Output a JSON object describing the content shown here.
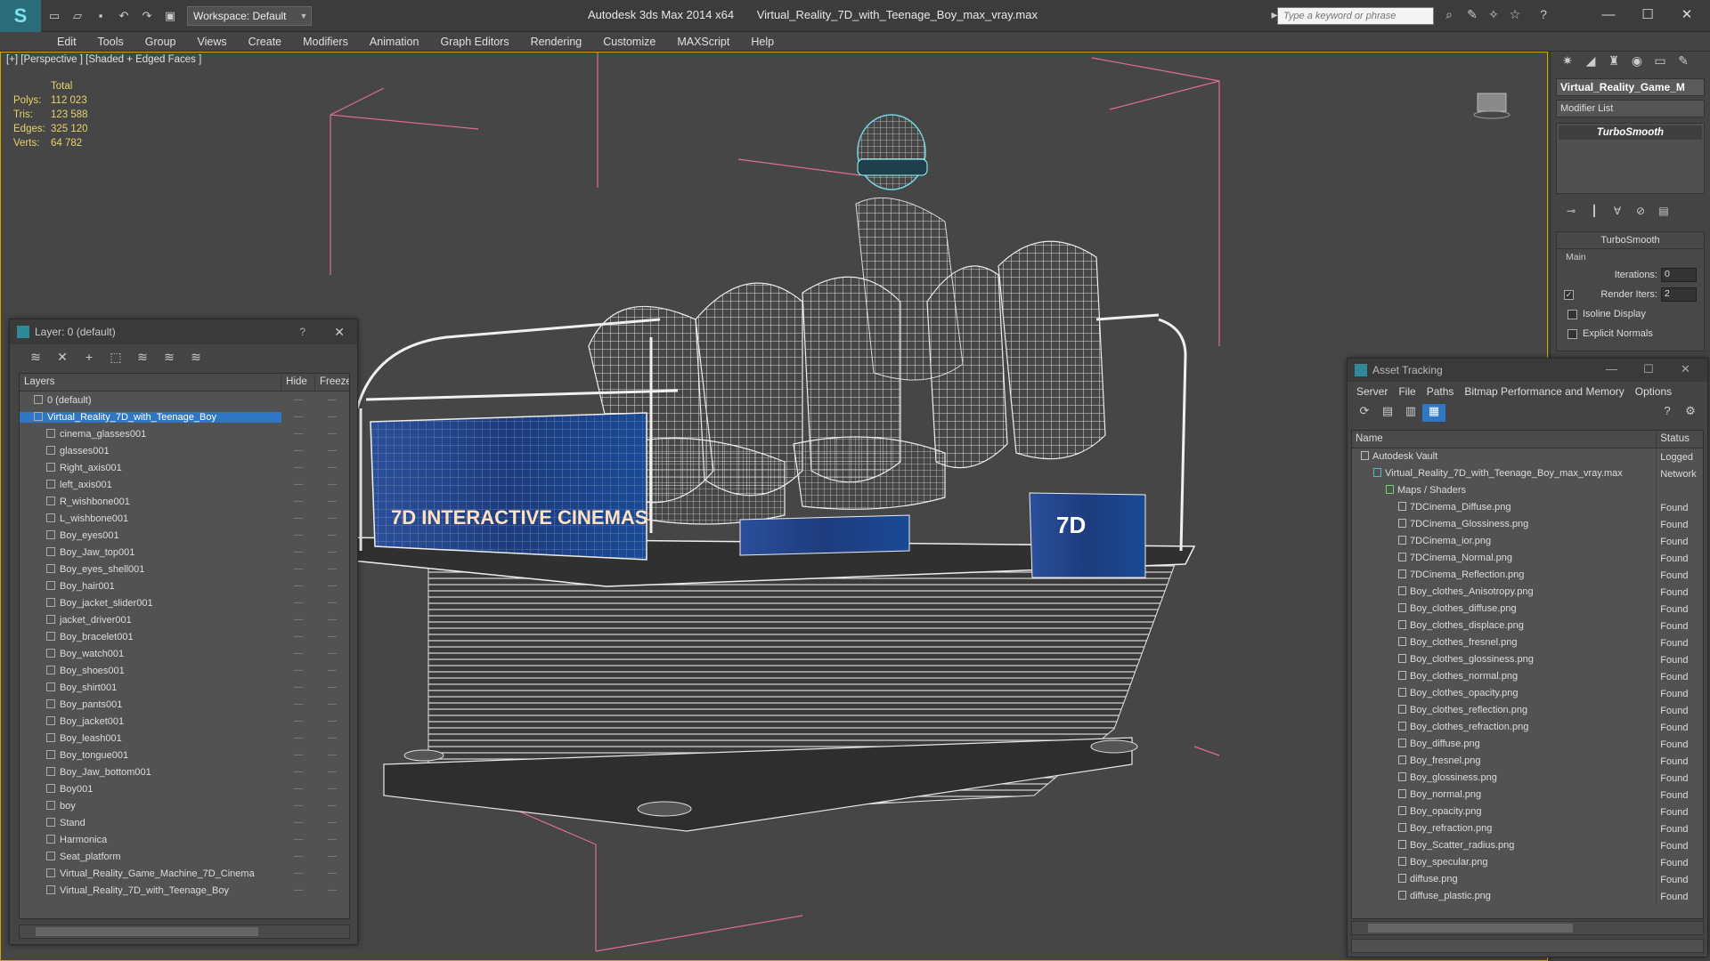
{
  "titlebar": {
    "workspace": "Workspace: Default",
    "app_title": "Autodesk 3ds Max  2014 x64",
    "file_title": "Virtual_Reality_7D_with_Teenage_Boy_max_vray.max",
    "search_placeholder": "Type a keyword or phrase"
  },
  "menu": [
    "Edit",
    "Tools",
    "Group",
    "Views",
    "Create",
    "Modifiers",
    "Animation",
    "Graph Editors",
    "Rendering",
    "Customize",
    "MAXScript",
    "Help"
  ],
  "viewport": {
    "label": "[+] [Perspective ] [Shaded + Edged Faces ]",
    "stats": {
      "header": "Total",
      "rows": [
        {
          "k": "Polys:",
          "v": "112 023"
        },
        {
          "k": "Tris:",
          "v": "123 588"
        },
        {
          "k": "Edges:",
          "v": "325 120"
        },
        {
          "k": "Verts:",
          "v": "64 782"
        }
      ]
    },
    "poster_text": "7D INTERACTIVE CINEMAS",
    "badge_text": "7D"
  },
  "layer_dialog": {
    "title": "Layer: 0 (default)",
    "help": "?",
    "columns": {
      "layers": "Layers",
      "hide": "Hide",
      "freeze": "Freeze"
    },
    "layers": [
      {
        "name": "0 (default)",
        "level": 1,
        "kind": "layer"
      },
      {
        "name": "Virtual_Reality_7D_with_Teenage_Boy",
        "level": 1,
        "kind": "layer",
        "selected": true
      },
      {
        "name": "cinema_glasses001",
        "level": 2,
        "kind": "obj"
      },
      {
        "name": "glasses001",
        "level": 2,
        "kind": "obj"
      },
      {
        "name": "Right_axis001",
        "level": 2,
        "kind": "obj"
      },
      {
        "name": "left_axis001",
        "level": 2,
        "kind": "obj"
      },
      {
        "name": "R_wishbone001",
        "level": 2,
        "kind": "obj"
      },
      {
        "name": "L_wishbone001",
        "level": 2,
        "kind": "obj"
      },
      {
        "name": "Boy_eyes001",
        "level": 2,
        "kind": "obj"
      },
      {
        "name": "Boy_Jaw_top001",
        "level": 2,
        "kind": "obj"
      },
      {
        "name": "Boy_eyes_shell001",
        "level": 2,
        "kind": "obj"
      },
      {
        "name": "Boy_hair001",
        "level": 2,
        "kind": "obj"
      },
      {
        "name": "Boy_jacket_slider001",
        "level": 2,
        "kind": "obj"
      },
      {
        "name": "jacket_driver001",
        "level": 2,
        "kind": "obj"
      },
      {
        "name": "Boy_bracelet001",
        "level": 2,
        "kind": "obj"
      },
      {
        "name": "Boy_watch001",
        "level": 2,
        "kind": "obj"
      },
      {
        "name": "Boy_shoes001",
        "level": 2,
        "kind": "obj"
      },
      {
        "name": "Boy_shirt001",
        "level": 2,
        "kind": "obj"
      },
      {
        "name": "Boy_pants001",
        "level": 2,
        "kind": "obj"
      },
      {
        "name": "Boy_jacket001",
        "level": 2,
        "kind": "obj"
      },
      {
        "name": "Boy_leash001",
        "level": 2,
        "kind": "obj"
      },
      {
        "name": "Boy_tongue001",
        "level": 2,
        "kind": "obj"
      },
      {
        "name": "Boy_Jaw_bottom001",
        "level": 2,
        "kind": "obj"
      },
      {
        "name": "Boy001",
        "level": 2,
        "kind": "obj"
      },
      {
        "name": "boy",
        "level": 2,
        "kind": "obj"
      },
      {
        "name": "Stand",
        "level": 2,
        "kind": "obj"
      },
      {
        "name": "Harmonica",
        "level": 2,
        "kind": "obj"
      },
      {
        "name": "Seat_platform",
        "level": 2,
        "kind": "obj"
      },
      {
        "name": "Virtual_Reality_Game_Machine_7D_Cinema",
        "level": 2,
        "kind": "obj"
      },
      {
        "name": "Virtual_Reality_7D_with_Teenage_Boy",
        "level": 2,
        "kind": "obj"
      }
    ]
  },
  "command_panel": {
    "object_name": "Virtual_Reality_Game_M",
    "modifier_list": "Modifier List",
    "stack_entry": "TurboSmooth",
    "rollout_title": "TurboSmooth",
    "group_main": "Main",
    "iterations_label": "Iterations:",
    "iterations_value": "0",
    "render_iters_label": "Render Iters:",
    "render_iters_value": "2",
    "render_iters_checked": true,
    "isoline_label": "Isoline Display",
    "explicit_label": "Explicit Normals"
  },
  "asset_dialog": {
    "title": "Asset Tracking",
    "menu": [
      "Server",
      "File",
      "Paths",
      "Bitmap Performance and Memory",
      "Options"
    ],
    "columns": {
      "name": "Name",
      "status": "Status"
    },
    "rows": [
      {
        "name": "Autodesk Vault",
        "status": "Logged",
        "level": 1,
        "kind": "vault"
      },
      {
        "name": "Virtual_Reality_7D_with_Teenage_Boy_max_vray.max",
        "status": "Network",
        "level": 2,
        "kind": "max"
      },
      {
        "name": "Maps / Shaders",
        "status": "",
        "level": 3,
        "kind": "folder"
      },
      {
        "name": "7DCinema_Diffuse.png",
        "status": "Found",
        "level": 4,
        "kind": "file"
      },
      {
        "name": "7DCinema_Glossiness.png",
        "status": "Found",
        "level": 4,
        "kind": "file"
      },
      {
        "name": "7DCinema_ior.png",
        "status": "Found",
        "level": 4,
        "kind": "file"
      },
      {
        "name": "7DCinema_Normal.png",
        "status": "Found",
        "level": 4,
        "kind": "file"
      },
      {
        "name": "7DCinema_Reflection.png",
        "status": "Found",
        "level": 4,
        "kind": "file"
      },
      {
        "name": "Boy_clothes_Anisotropy.png",
        "status": "Found",
        "level": 4,
        "kind": "file"
      },
      {
        "name": "Boy_clothes_diffuse.png",
        "status": "Found",
        "level": 4,
        "kind": "file"
      },
      {
        "name": "Boy_clothes_displace.png",
        "status": "Found",
        "level": 4,
        "kind": "file"
      },
      {
        "name": "Boy_clothes_fresnel.png",
        "status": "Found",
        "level": 4,
        "kind": "file"
      },
      {
        "name": "Boy_clothes_glossiness.png",
        "status": "Found",
        "level": 4,
        "kind": "file"
      },
      {
        "name": "Boy_clothes_normal.png",
        "status": "Found",
        "level": 4,
        "kind": "file"
      },
      {
        "name": "Boy_clothes_opacity.png",
        "status": "Found",
        "level": 4,
        "kind": "file"
      },
      {
        "name": "Boy_clothes_reflection.png",
        "status": "Found",
        "level": 4,
        "kind": "file"
      },
      {
        "name": "Boy_clothes_refraction.png",
        "status": "Found",
        "level": 4,
        "kind": "file"
      },
      {
        "name": "Boy_diffuse.png",
        "status": "Found",
        "level": 4,
        "kind": "file"
      },
      {
        "name": "Boy_fresnel.png",
        "status": "Found",
        "level": 4,
        "kind": "file"
      },
      {
        "name": "Boy_glossiness.png",
        "status": "Found",
        "level": 4,
        "kind": "file"
      },
      {
        "name": "Boy_normal.png",
        "status": "Found",
        "level": 4,
        "kind": "file"
      },
      {
        "name": "Boy_opacity.png",
        "status": "Found",
        "level": 4,
        "kind": "file"
      },
      {
        "name": "Boy_refraction.png",
        "status": "Found",
        "level": 4,
        "kind": "file"
      },
      {
        "name": "Boy_Scatter_radius.png",
        "status": "Found",
        "level": 4,
        "kind": "file"
      },
      {
        "name": "Boy_specular.png",
        "status": "Found",
        "level": 4,
        "kind": "file"
      },
      {
        "name": "diffuse.png",
        "status": "Found",
        "level": 4,
        "kind": "file"
      },
      {
        "name": "diffuse_plastic.png",
        "status": "Found",
        "level": 4,
        "kind": "file"
      }
    ]
  },
  "colors": {
    "viewport_border": "#d6a300",
    "selection": "#2f76c4",
    "stats_text": "#e9d36a",
    "wire": "#e8e8e8",
    "guide_lines": "#e06b9a"
  }
}
